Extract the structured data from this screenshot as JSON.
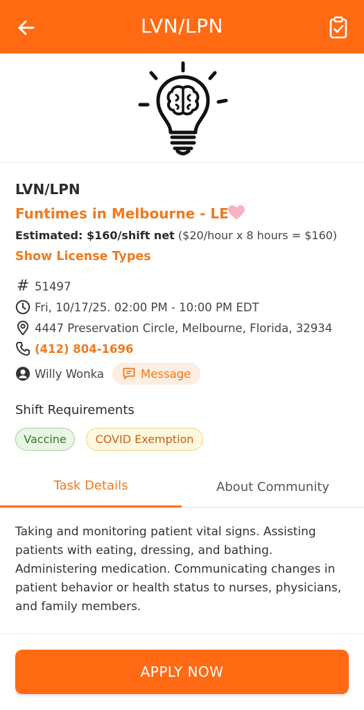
{
  "header": {
    "title": "LVN/LPN",
    "back_icon": "arrow-left-icon",
    "action_icon": "clipboard-check-icon",
    "bg_color": "#ff6a13"
  },
  "hero": {
    "icon": "lightbulb-brain-icon"
  },
  "job": {
    "title": "LVN/LPN",
    "community": "Funtimes in Melbourne - LE",
    "favorite_icon": "heart-icon",
    "estimated_label": "Estimated: $160/shift net",
    "estimated_calc": "($20/hour x 8 hours = $160)",
    "license_link": "Show License Types"
  },
  "info": {
    "id": "51497",
    "datetime": "Fri, 10/17/25. 02:00 PM - 10:00 PM EDT",
    "address": "4447 Preservation Circle, Melbourne, Florida, 32934",
    "phone": "(412) 804-1696",
    "contact_name": "Willy Wonka",
    "message_label": "Message"
  },
  "requirements": {
    "heading": "Shift Requirements",
    "chips": [
      "Vaccine",
      "COVID Exemption"
    ]
  },
  "tabs": [
    {
      "label": "Task Details",
      "active": true
    },
    {
      "label": "About Community",
      "active": false
    }
  ],
  "task_details": "Taking and monitoring patient vital signs. Assisting patients with eating, dressing, and bathing. Administering medication. Communicating changes in patient behavior or health status to nurses, physicians, and family members.",
  "apply_label": "APPLY NOW",
  "colors": {
    "accent": "#ef7a1d",
    "brand": "#ff6a13"
  }
}
